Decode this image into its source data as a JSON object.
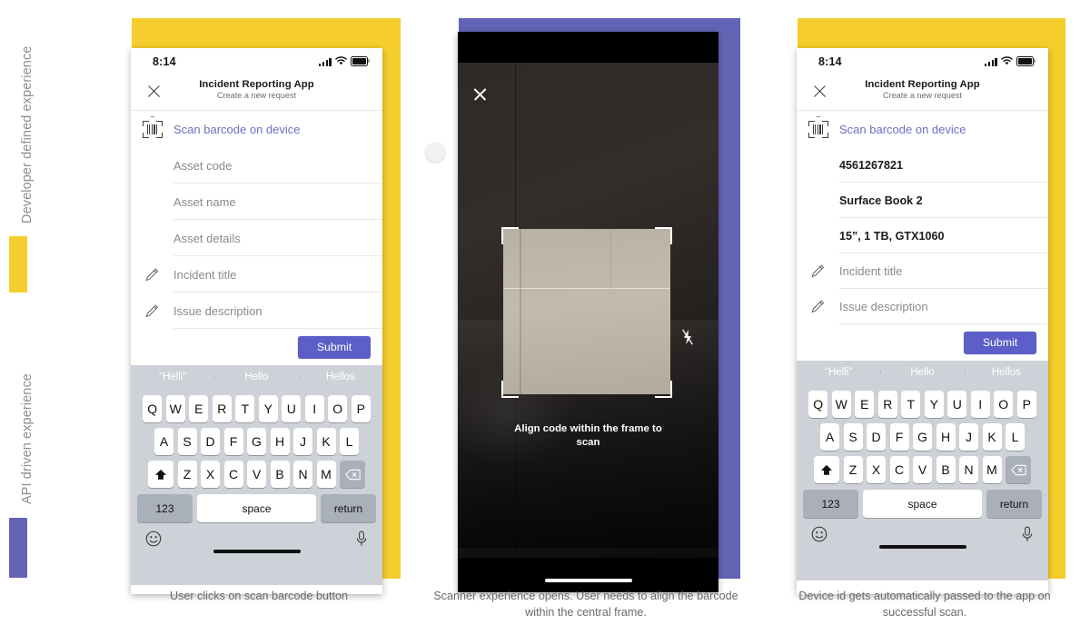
{
  "rail": {
    "labels": [
      {
        "text": "Developer defined experience"
      },
      {
        "text": "API driven experience"
      }
    ],
    "bars": [
      {
        "color": "#f5ce2d"
      },
      {
        "color": "#6264b5"
      }
    ]
  },
  "colors": {
    "yellow_panel": "#f5ce2d",
    "purple_panel": "#6264b5",
    "accent_purple": "#5b5fc7",
    "link_purple": "#6d6fc4",
    "keyboard_bg": "#ced2d8"
  },
  "status_bar": {
    "time": "8:14",
    "signal_icon": "signal-bars-icon",
    "wifi_icon": "wifi-icon",
    "battery_icon": "battery-icon"
  },
  "app_header": {
    "close_icon": "close-icon",
    "title": "Incident Reporting App",
    "subtitle": "Create a new request"
  },
  "keyboard": {
    "suggestions": [
      "“Helli”",
      "Hello",
      "Hellos"
    ],
    "row1": [
      "Q",
      "W",
      "E",
      "R",
      "T",
      "Y",
      "U",
      "I",
      "O",
      "P"
    ],
    "row2": [
      "A",
      "S",
      "D",
      "F",
      "G",
      "H",
      "J",
      "K",
      "L"
    ],
    "row3": [
      "Z",
      "X",
      "C",
      "V",
      "B",
      "N",
      "M"
    ],
    "shift_icon": "shift-arrow-icon",
    "backspace_icon": "backspace-icon",
    "numeric_label": "123",
    "space_label": "space",
    "return_label": "return",
    "emoji_icon": "emoji-smiley-icon",
    "mic_icon": "microphone-icon",
    "home_indicator": "home-indicator"
  },
  "panels": [
    {
      "id": "panel-left",
      "bg_color": "#f5ce2d",
      "caption": "User clicks on scan barcode button",
      "screen": {
        "type": "form",
        "rows": [
          {
            "name": "scan-barcode-row",
            "icon": "barcode-scan-icon",
            "text": "Scan barcode on device",
            "style": "link",
            "separator": false
          },
          {
            "name": "asset-code-row",
            "icon": null,
            "text": "Asset code",
            "style": "placeholder",
            "separator": true
          },
          {
            "name": "asset-name-row",
            "icon": null,
            "text": "Asset name",
            "style": "placeholder",
            "separator": true
          },
          {
            "name": "asset-details-row",
            "icon": null,
            "text": "Asset details",
            "style": "placeholder",
            "separator": true
          },
          {
            "name": "incident-title-row",
            "icon": "pencil-icon",
            "text": "Incident title",
            "style": "placeholder",
            "separator": true
          },
          {
            "name": "issue-description-row",
            "icon": "pencil-icon",
            "text": "Issue description",
            "style": "placeholder",
            "separator": true
          }
        ],
        "submit_label": "Submit"
      }
    },
    {
      "id": "panel-middle",
      "bg_color": "#6264b5",
      "caption": "Scanner experience opens. User needs to align the barcode within the central frame.",
      "screen": {
        "type": "scanner",
        "close_icon": "close-icon",
        "flash_icon": "flash-off-icon",
        "hint": "Align code within the frame to scan"
      }
    },
    {
      "id": "panel-right",
      "bg_color": "#f5ce2d",
      "caption": "Device id gets automatically passed to the app on successful scan.",
      "screen": {
        "type": "form",
        "rows": [
          {
            "name": "scan-barcode-row",
            "icon": "barcode-scan-icon",
            "text": "Scan barcode on device",
            "style": "link",
            "separator": false
          },
          {
            "name": "asset-code-row",
            "icon": null,
            "text": "4561267821",
            "style": "value",
            "separator": true
          },
          {
            "name": "asset-name-row",
            "icon": null,
            "text": "Surface Book 2",
            "style": "value",
            "separator": true
          },
          {
            "name": "asset-details-row",
            "icon": null,
            "text": "15”, 1 TB, GTX1060",
            "style": "value",
            "separator": true
          },
          {
            "name": "incident-title-row",
            "icon": "pencil-icon",
            "text": "Incident title",
            "style": "placeholder",
            "separator": true
          },
          {
            "name": "issue-description-row",
            "icon": "pencil-icon",
            "text": "Issue description",
            "style": "placeholder",
            "separator": true
          }
        ],
        "submit_label": "Submit"
      }
    }
  ]
}
